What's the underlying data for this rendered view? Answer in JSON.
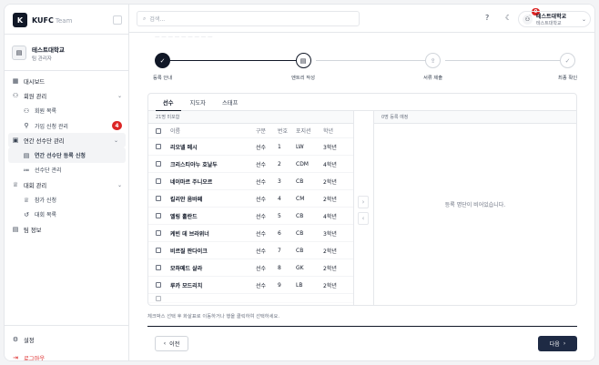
{
  "brand": {
    "logo": "K",
    "name": "KUFC",
    "sub": "Team"
  },
  "org": {
    "name": "테스트대학교",
    "role": "팀 관리자",
    "icon": "building-icon"
  },
  "nav": {
    "dashboard": "대시보드",
    "members": "회원 관리",
    "member_list": "회원 목록",
    "join_requests": "가입 신청 관리",
    "join_requests_badge": "4",
    "annual": "연간 선수단 관리",
    "annual_register": "연간 선수단 등록 신청",
    "roster": "선수단 관리",
    "tournament": "대회 관리",
    "entry": "참가 신청",
    "tournament_list": "대회 목록",
    "team_info": "팀 정보",
    "settings": "설정",
    "logout": "로그아웃"
  },
  "header": {
    "search_placeholder": "검색...",
    "notif_count": "0",
    "user_name": "테스트대학교",
    "user_sub": "테스트대학교"
  },
  "steps": [
    {
      "label": "등록 안내",
      "state": "done"
    },
    {
      "label": "엔트리 작성",
      "state": "current"
    },
    {
      "label": "서류 제출",
      "state": "todo"
    },
    {
      "label": "최종 확인",
      "state": "todo"
    }
  ],
  "tabs": [
    "선수",
    "지도자",
    "스태프"
  ],
  "left": {
    "count_label": "21명 미포함",
    "columns": [
      "이름",
      "구분",
      "번호",
      "포지션",
      "학년"
    ],
    "rows": [
      {
        "name": "리오넬 메시",
        "type": "선수",
        "num": "1",
        "pos": "LW",
        "grade": "3학년"
      },
      {
        "name": "크리스티아누 호날두",
        "type": "선수",
        "num": "2",
        "pos": "CDM",
        "grade": "4학년"
      },
      {
        "name": "네이마르 주니오르",
        "type": "선수",
        "num": "3",
        "pos": "CB",
        "grade": "2학년"
      },
      {
        "name": "킬리안 음바페",
        "type": "선수",
        "num": "4",
        "pos": "CM",
        "grade": "2학년"
      },
      {
        "name": "엘링 홀란드",
        "type": "선수",
        "num": "5",
        "pos": "CB",
        "grade": "4학년"
      },
      {
        "name": "케빈 데 브라위너",
        "type": "선수",
        "num": "6",
        "pos": "CB",
        "grade": "3학년"
      },
      {
        "name": "비르질 판다이크",
        "type": "선수",
        "num": "7",
        "pos": "CB",
        "grade": "2학년"
      },
      {
        "name": "모하메드 살라",
        "type": "선수",
        "num": "8",
        "pos": "GK",
        "grade": "2학년"
      },
      {
        "name": "루카 모드리치",
        "type": "선수",
        "num": "9",
        "pos": "LB",
        "grade": "2학년"
      }
    ]
  },
  "right": {
    "count_label": "0명 등록 예정",
    "empty": "등록 명단이 비어있습니다."
  },
  "hint": "체크박스 선택 후 화살표로 이동하거나 행을 클릭하여 선택하세요.",
  "buttons": {
    "prev": "이전",
    "next": "다음"
  }
}
